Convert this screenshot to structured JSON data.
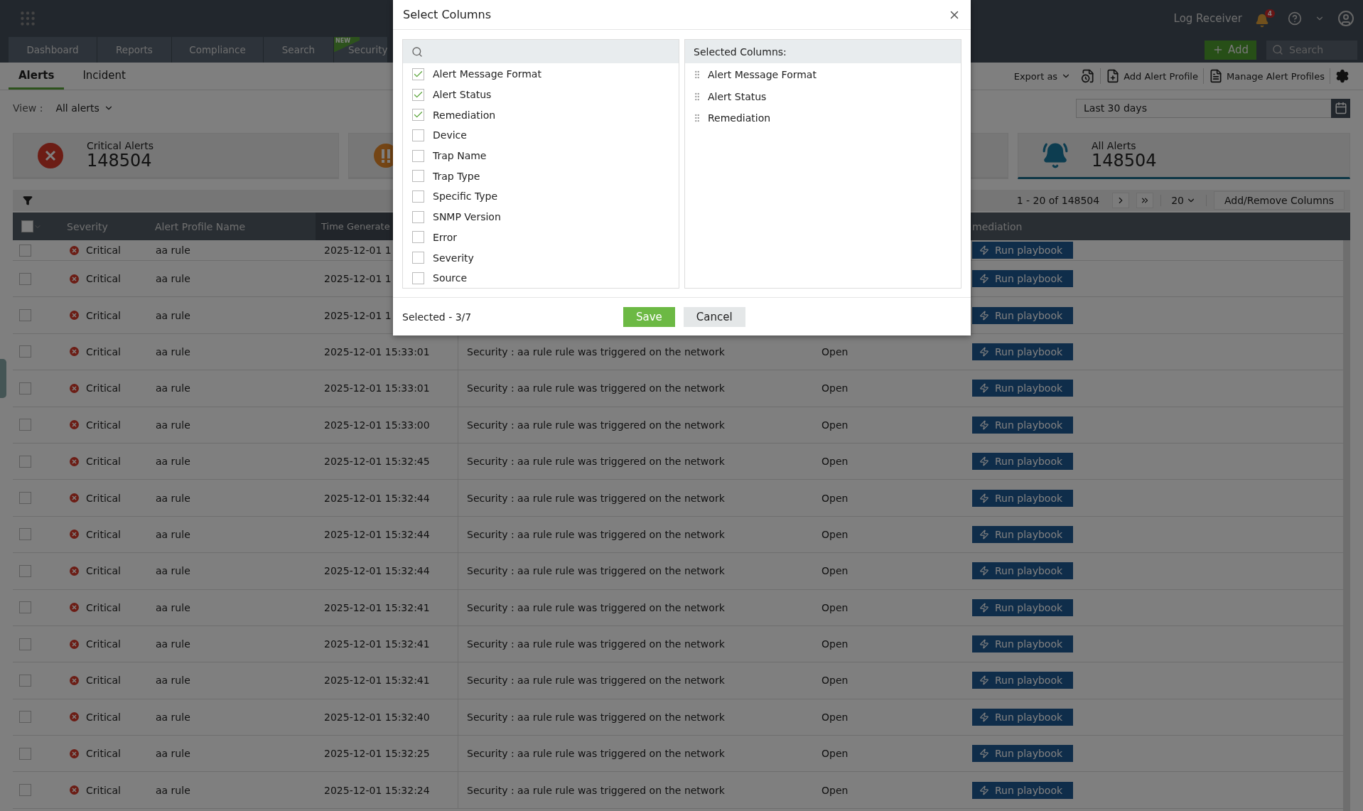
{
  "top_bar": {
    "nav_tabs": [
      {
        "label": "Dashboard",
        "selected": false
      },
      {
        "label": "Reports",
        "selected": false
      },
      {
        "label": "Compliance",
        "selected": false
      },
      {
        "label": "Search",
        "selected": false
      },
      {
        "label": "Security",
        "selected": false,
        "badge": "NEW"
      }
    ],
    "log_receiver": "Log Receiver",
    "notification_count": "4",
    "add_button": "Add",
    "search": {
      "placeholder": "Search"
    }
  },
  "sub_tabs": [
    {
      "label": "Alerts",
      "selected": true
    },
    {
      "label": "Incident",
      "selected": false
    }
  ],
  "toolbar": {
    "export": "Export as",
    "add_profile": "Add Alert Profile",
    "manage_profiles": "Manage Alert Profiles"
  },
  "view": {
    "label": "View :",
    "value": "All alerts"
  },
  "date_range": {
    "value": "Last 30 days"
  },
  "summary_cards": [
    {
      "kind": "critical",
      "label": "Critical Alerts",
      "count": "148504",
      "selected": false
    },
    {
      "kind": "warning",
      "selected": false
    },
    {
      "kind": "all",
      "label": "All Alerts",
      "count": "148504",
      "selected": true
    }
  ],
  "pagination": {
    "range": "1 - 20 of 148504",
    "page_size": "20",
    "columns_button": "Add/Remove Columns"
  },
  "table": {
    "select_all_checked": false,
    "columns": [
      "Severity",
      "Alert Profile Name",
      "Time Generate",
      "mediation"
    ],
    "rows": [
      {
        "checked": false,
        "severity": "Critical",
        "profile": "aa rule",
        "time": "2025-12-01 1",
        "action": "Run playbook"
      },
      {
        "checked": false,
        "severity": "Critical",
        "profile": "aa rule",
        "time": "2025-12-01 1",
        "action": "Run playbook"
      },
      {
        "checked": false,
        "severity": "Critical",
        "profile": "aa rule",
        "time": "2025-12-01 1",
        "action": "Run playbook"
      },
      {
        "checked": false,
        "severity": "Critical",
        "profile": "aa rule",
        "time": "2025-12-01 15:33:01",
        "message": "Security : aa rule rule was triggered on the network",
        "status": "Open",
        "action": "Run playbook"
      },
      {
        "checked": false,
        "severity": "Critical",
        "profile": "aa rule",
        "time": "2025-12-01 15:33:01",
        "message": "Security : aa rule rule was triggered on the network",
        "status": "Open",
        "action": "Run playbook"
      },
      {
        "checked": false,
        "severity": "Critical",
        "profile": "aa rule",
        "time": "2025-12-01 15:33:00",
        "message": "Security : aa rule rule was triggered on the network",
        "status": "Open",
        "action": "Run playbook"
      },
      {
        "checked": false,
        "severity": "Critical",
        "profile": "aa rule",
        "time": "2025-12-01 15:32:45",
        "message": "Security : aa rule rule was triggered on the network",
        "status": "Open",
        "action": "Run playbook"
      },
      {
        "checked": false,
        "severity": "Critical",
        "profile": "aa rule",
        "time": "2025-12-01 15:32:44",
        "message": "Security : aa rule rule was triggered on the network",
        "status": "Open",
        "action": "Run playbook"
      },
      {
        "checked": false,
        "severity": "Critical",
        "profile": "aa rule",
        "time": "2025-12-01 15:32:44",
        "message": "Security : aa rule rule was triggered on the network",
        "status": "Open",
        "action": "Run playbook"
      },
      {
        "checked": false,
        "severity": "Critical",
        "profile": "aa rule",
        "time": "2025-12-01 15:32:44",
        "message": "Security : aa rule rule was triggered on the network",
        "status": "Open",
        "action": "Run playbook"
      },
      {
        "checked": false,
        "severity": "Critical",
        "profile": "aa rule",
        "time": "2025-12-01 15:32:41",
        "message": "Security : aa rule rule was triggered on the network",
        "status": "Open",
        "action": "Run playbook"
      },
      {
        "checked": false,
        "severity": "Critical",
        "profile": "aa rule",
        "time": "2025-12-01 15:32:41",
        "message": "Security : aa rule rule was triggered on the network",
        "status": "Open",
        "action": "Run playbook"
      },
      {
        "checked": false,
        "severity": "Critical",
        "profile": "aa rule",
        "time": "2025-12-01 15:32:41",
        "message": "Security : aa rule rule was triggered on the network",
        "status": "Open",
        "action": "Run playbook"
      },
      {
        "checked": false,
        "severity": "Critical",
        "profile": "aa rule",
        "time": "2025-12-01 15:32:40",
        "message": "Security : aa rule rule was triggered on the network",
        "status": "Open",
        "action": "Run playbook"
      },
      {
        "checked": false,
        "severity": "Critical",
        "profile": "aa rule",
        "time": "2025-12-01 15:32:25",
        "message": "Security : aa rule rule was triggered on the network",
        "status": "Open",
        "action": "Run playbook"
      },
      {
        "checked": false,
        "severity": "Critical",
        "profile": "aa rule",
        "time": "2025-12-01 15:32:24",
        "message": "Security : aa rule rule was triggered on the network",
        "status": "Open",
        "action": "Run playbook"
      }
    ]
  },
  "dialog": {
    "title": "Select Columns",
    "options": [
      {
        "label": "Alert Message Format",
        "checked": true
      },
      {
        "label": "Alert Status",
        "checked": true
      },
      {
        "label": "Remediation",
        "checked": true
      },
      {
        "label": "Device",
        "checked": false
      },
      {
        "label": "Trap Name",
        "checked": false
      },
      {
        "label": "Trap Type",
        "checked": false
      },
      {
        "label": "Specific Type",
        "checked": false
      },
      {
        "label": "SNMP Version",
        "checked": false
      },
      {
        "label": "Error",
        "checked": false
      },
      {
        "label": "Severity",
        "checked": false
      },
      {
        "label": "Source",
        "checked": false
      }
    ],
    "selected_heading": "Selected Columns:",
    "selected_columns": [
      "Alert Message Format",
      "Alert Status",
      "Remediation"
    ],
    "footer": "Selected - 3/7",
    "buttons": [
      {
        "label": "Save",
        "kind": "primary"
      },
      {
        "label": "Cancel",
        "kind": "secondary"
      }
    ]
  }
}
